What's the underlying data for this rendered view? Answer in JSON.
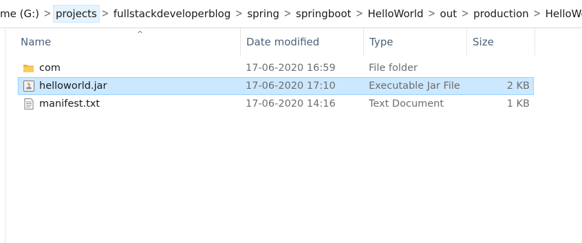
{
  "breadcrumb": {
    "items": [
      "me (G:)",
      "projects",
      "fullstackdeveloperblog",
      "spring",
      "springboot",
      "HelloWorld",
      "out",
      "production",
      "HelloWorld"
    ],
    "separator": ">"
  },
  "columns": {
    "name": "Name",
    "date": "Date modified",
    "type": "Type",
    "size": "Size",
    "sort_indicator": "^"
  },
  "files": [
    {
      "name": "com",
      "date": "17-06-2020 16:59",
      "type": "File folder",
      "size": "",
      "icon": "folder-icon",
      "selected": false
    },
    {
      "name": "helloworld.jar",
      "date": "17-06-2020 17:10",
      "type": "Executable Jar File",
      "size": "2 KB",
      "icon": "java-jar-icon",
      "selected": true
    },
    {
      "name": "manifest.txt",
      "date": "17-06-2020 14:16",
      "type": "Text Document",
      "size": "1 KB",
      "icon": "text-file-icon",
      "selected": false
    }
  ],
  "colors": {
    "selection_bg": "#cce8ff",
    "selection_border": "#99d1ff",
    "header_text": "#4c607a",
    "secondary_text": "#6d6d6d",
    "folder": "#f4c24a"
  }
}
